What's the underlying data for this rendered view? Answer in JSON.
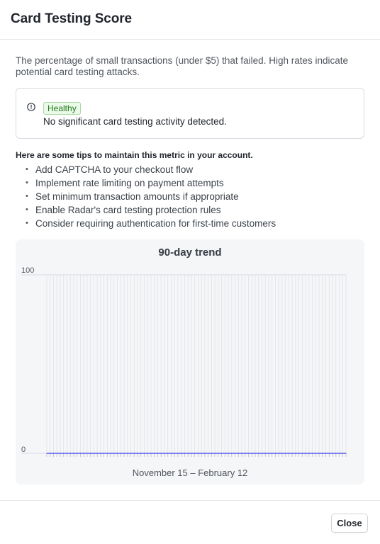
{
  "modal": {
    "title": "Card Testing Score",
    "description": "The percentage of small transactions (under $5) that failed. High rates indicate potential card testing attacks."
  },
  "status": {
    "icon": "alert-circle-icon",
    "badge": "Healthy",
    "message": "No significant card testing activity detected.",
    "badge_color": "#217a1d"
  },
  "tips": {
    "heading": "Here are some tips to maintain this metric in your account.",
    "items": [
      "Add CAPTCHA to your checkout flow",
      "Implement rate limiting on payment attempts",
      "Set minimum transaction amounts if appropriate",
      "Enable Radar's card testing protection rules",
      "Consider requiring authentication for first-time customers"
    ]
  },
  "chart": {
    "title": "90-day trend",
    "range_label": "November 15 – February 12"
  },
  "chart_data": {
    "type": "line",
    "title": "90-day trend",
    "xlabel": "November 15 – February 12",
    "ylabel": "",
    "ylim": [
      0,
      100
    ],
    "y_ticks": [
      "100",
      "0"
    ],
    "grid": true,
    "series": [
      {
        "color": "#5b5bf0",
        "values": [
          0,
          0,
          0,
          0,
          0,
          0,
          0,
          0,
          0,
          0,
          0,
          0,
          0,
          0,
          0,
          0,
          0,
          0,
          0,
          0,
          0,
          0,
          0,
          0,
          0,
          0,
          0,
          0,
          0,
          0,
          0,
          0,
          0,
          0,
          0,
          0,
          0,
          0,
          0,
          0,
          0,
          0,
          0,
          0,
          0,
          0,
          0,
          0,
          0,
          0,
          0,
          0,
          0,
          0,
          0,
          0,
          0,
          0,
          0,
          0,
          0,
          0,
          0,
          0,
          0,
          0,
          0,
          0,
          0,
          0,
          0,
          0,
          0,
          0,
          0,
          0,
          0,
          0,
          0,
          0,
          0,
          0,
          0,
          0,
          0,
          0,
          0,
          0,
          0,
          0
        ]
      }
    ]
  },
  "footer": {
    "close_label": "Close"
  }
}
